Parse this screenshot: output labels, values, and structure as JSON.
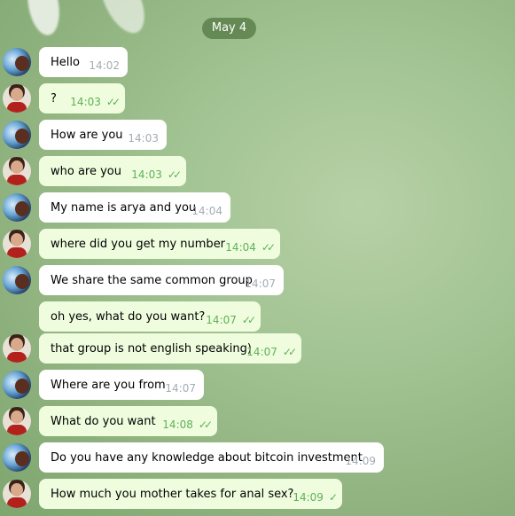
{
  "date_label": "May 4",
  "messages": [
    {
      "dir": "in",
      "text": "Hello",
      "time": "14:02",
      "status": ""
    },
    {
      "dir": "out",
      "text": "?",
      "time": "14:03",
      "status": "read"
    },
    {
      "dir": "in",
      "text": "How are you",
      "time": "14:03",
      "status": ""
    },
    {
      "dir": "out",
      "text": "who are you",
      "time": "14:03",
      "status": "read"
    },
    {
      "dir": "in",
      "text": "My name is arya and you",
      "time": "14:04",
      "status": ""
    },
    {
      "dir": "out",
      "text": "where did you get my number",
      "time": "14:04",
      "status": "read"
    },
    {
      "dir": "in",
      "text": "We share the same common group",
      "time": "14:07",
      "status": ""
    },
    {
      "dir": "out",
      "text": "oh yes, what do you want?",
      "time": "14:07",
      "status": "read"
    },
    {
      "dir": "out",
      "text": "that group is not english speaking)",
      "time": "14:07",
      "status": "read"
    },
    {
      "dir": "in",
      "text": "Where are you from",
      "time": "14:07",
      "status": ""
    },
    {
      "dir": "out",
      "text": "What do you want",
      "time": "14:08",
      "status": "read"
    },
    {
      "dir": "in",
      "text": "Do you have any knowledge about bitcoin investment",
      "time": "14:09",
      "status": ""
    },
    {
      "dir": "out",
      "text": "How much you mother takes for anal sex?",
      "time": "14:09",
      "status": "sent"
    }
  ],
  "icons": {
    "in_avatar": "contact-avatar",
    "out_avatar": "user-avatar",
    "read": "double-check-icon",
    "sent": "single-check-icon"
  },
  "colors": {
    "incoming_bubble": "#ffffff",
    "outgoing_bubble": "#effdde",
    "check": "#5fb057",
    "date_pill": "#5c804a"
  }
}
